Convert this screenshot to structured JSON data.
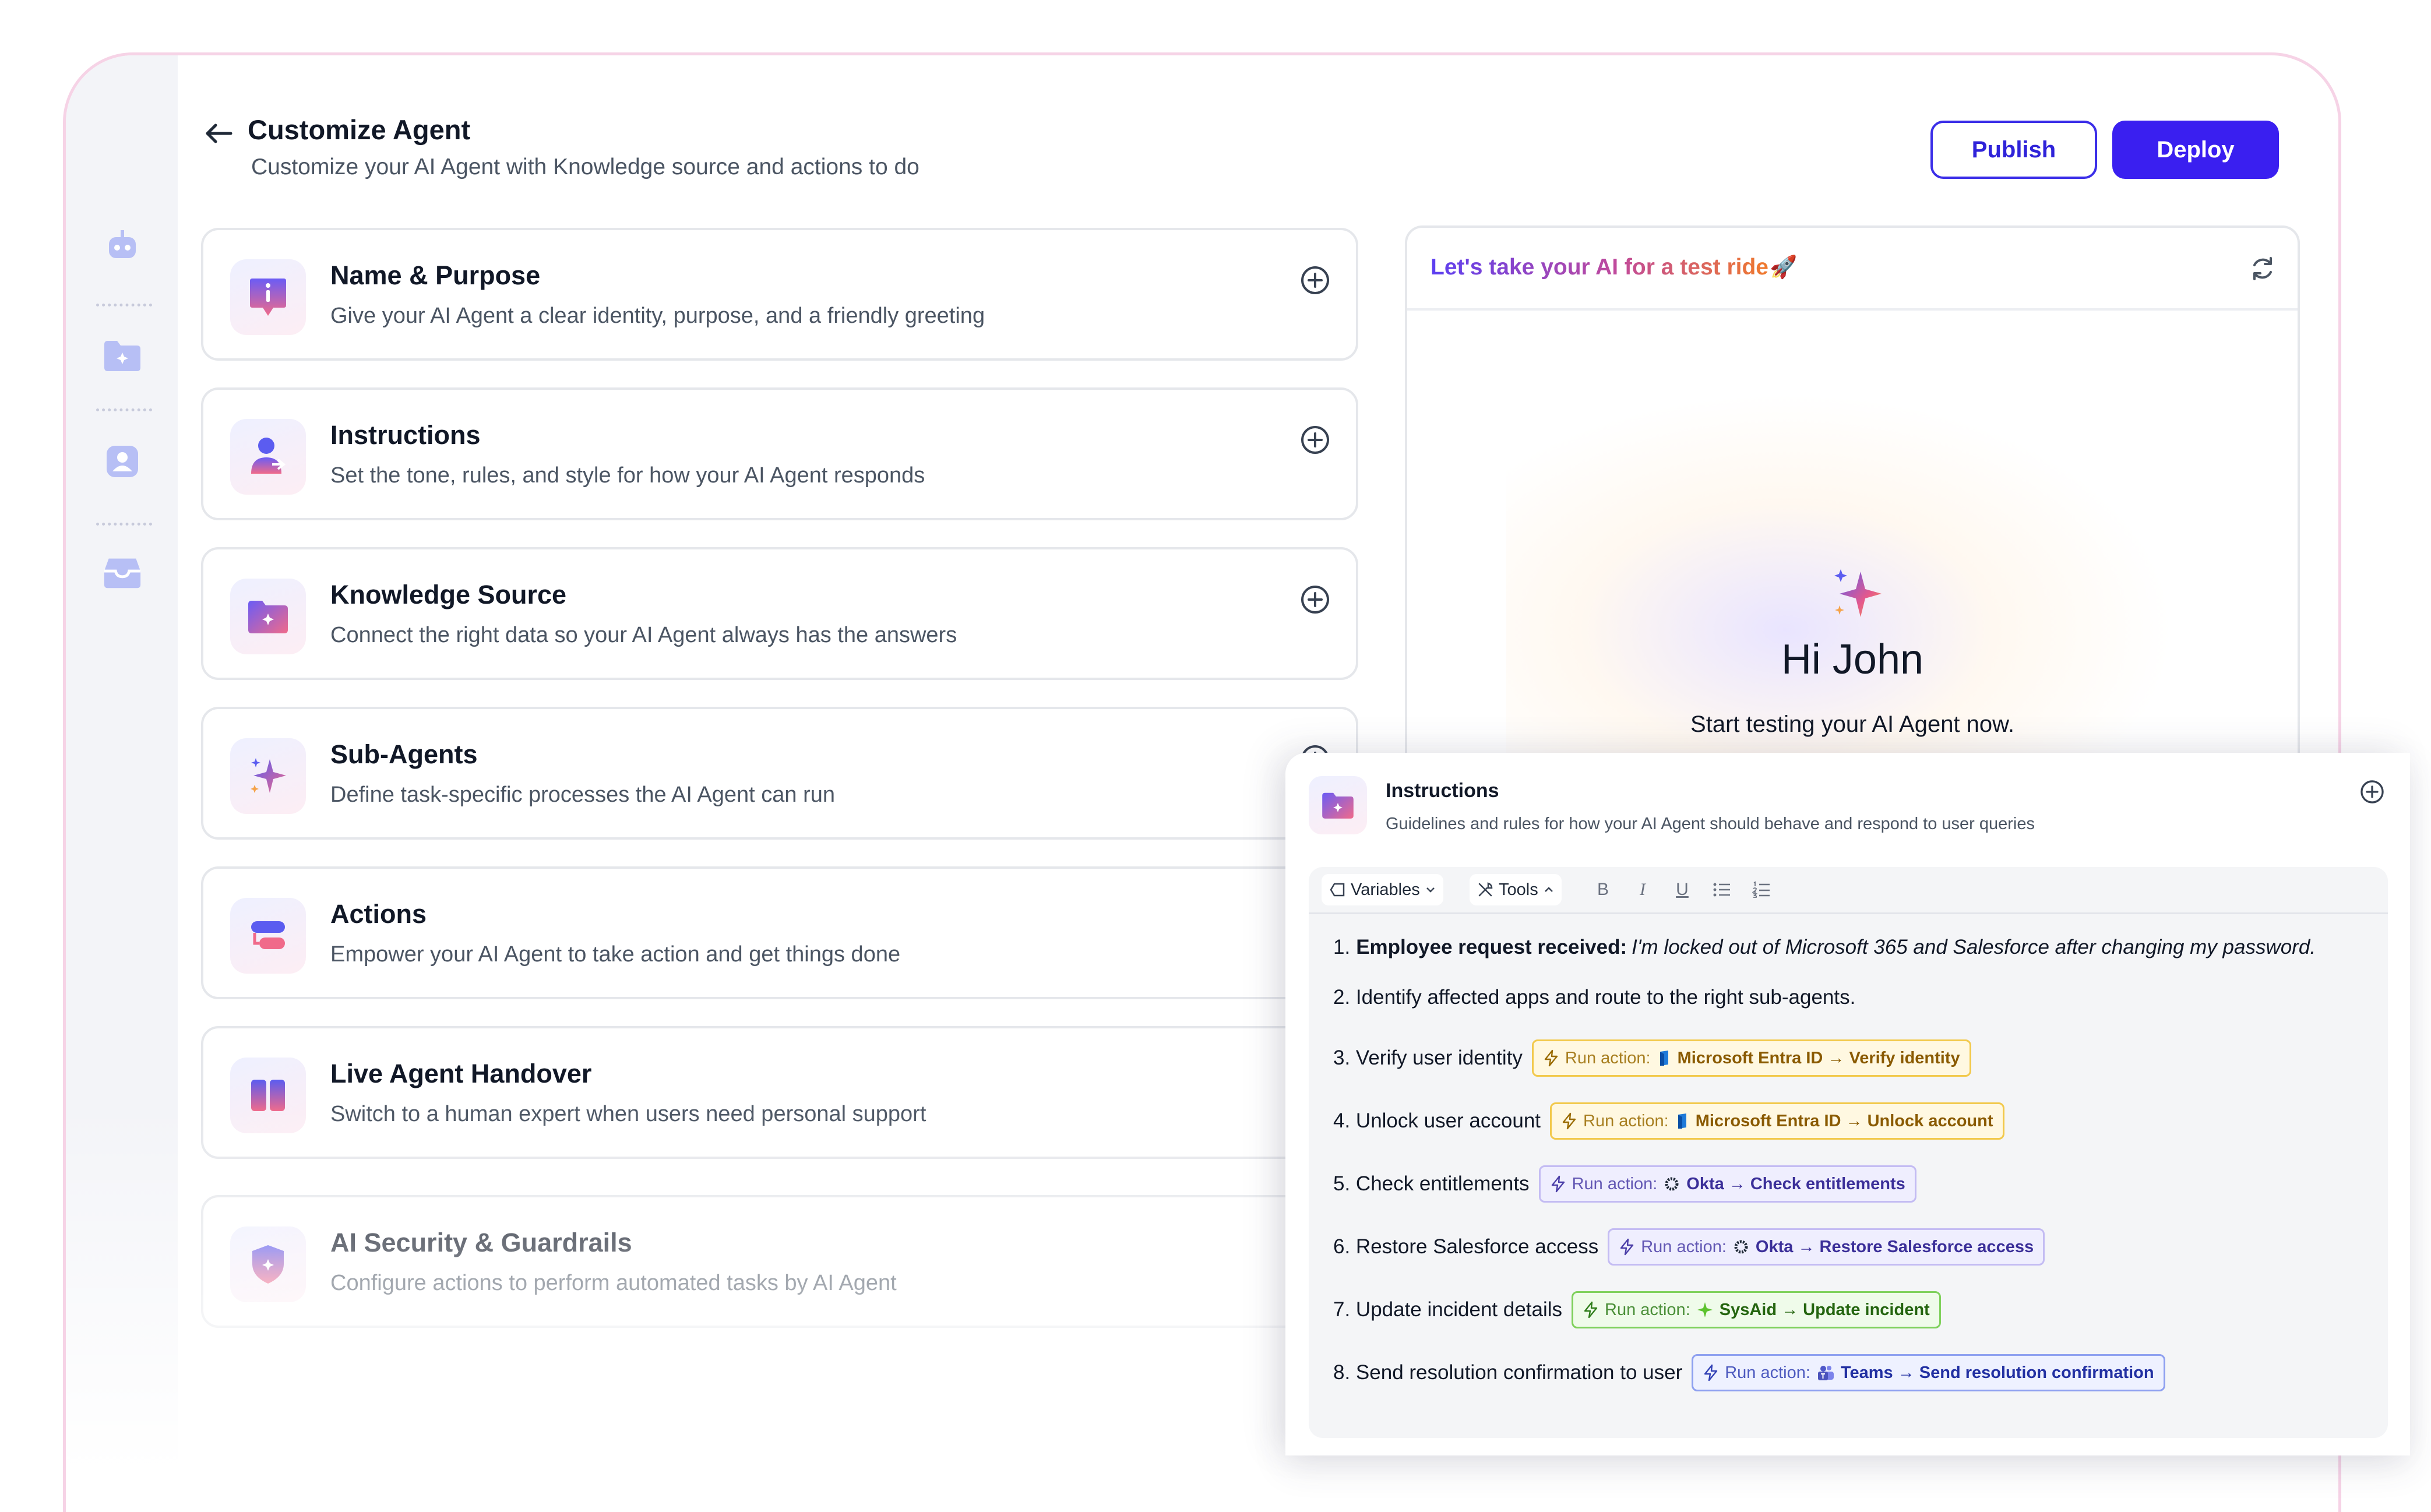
{
  "header": {
    "title": "Customize Agent",
    "subtitle": "Customize your AI Agent with Knowledge source and actions to do",
    "publish_label": "Publish",
    "deploy_label": "Deploy"
  },
  "sidebar": {
    "items": [
      "robot-icon",
      "folder-sparkle-icon",
      "user-card-icon",
      "inbox-icon"
    ]
  },
  "cards": [
    {
      "title": "Name & Purpose",
      "desc": "Give your AI Agent a clear identity, purpose, and a friendly greeting",
      "icon": "info-badge-icon"
    },
    {
      "title": "Instructions",
      "desc": "Set the tone, rules, and style for how your AI Agent responds",
      "icon": "user-edit-icon"
    },
    {
      "title": "Knowledge Source",
      "desc": "Connect the right data so your AI Agent always has the answers",
      "icon": "folder-sparkle-icon"
    },
    {
      "title": "Sub-Agents",
      "desc": "Define task-specific processes the AI Agent can run",
      "icon": "sparkle-icon"
    },
    {
      "title": "Actions",
      "desc": "Empower your AI Agent to take action and get things done",
      "icon": "actions-icon"
    },
    {
      "title": "Live Agent Handover",
      "desc": "Switch to a human expert when users need personal support",
      "icon": "handover-icon"
    },
    {
      "title": "AI Security & Guardrails",
      "desc": "Configure actions to perform automated tasks by AI Agent",
      "icon": "shield-icon"
    }
  ],
  "test_panel": {
    "title": "Let's take your AI for a test ride",
    "rocket": "🚀",
    "greeting": "Hi John",
    "prompt": "Start testing your AI Agent now."
  },
  "instructions_panel": {
    "title": "Instructions",
    "desc": "Guidelines and rules for how your AI Agent should behave and respond to user queries",
    "toolbar": {
      "variables_label": "Variables",
      "tools_label": "Tools",
      "bold": "B",
      "italic": "I",
      "underline": "U"
    },
    "step1": {
      "num": "1.",
      "label": "Employee request received:",
      "quote": "I'm locked out of Microsoft 365 and Salesforce after changing my password."
    },
    "step2": {
      "text": "2. Identify affected apps and route to the right sub-agents."
    },
    "steps": [
      {
        "text": "3. Verify user identity",
        "action_label": "Run action:",
        "target": "Microsoft Entra ID → Verify identity",
        "color": "yellow"
      },
      {
        "text": "4. Unlock user account",
        "action_label": "Run action:",
        "target": "Microsoft Entra ID → Unlock account",
        "color": "yellow"
      },
      {
        "text": "5.  Check entitlements",
        "action_label": "Run action:",
        "target": "Okta → Check entitlements",
        "color": "purple"
      },
      {
        "text": "6. Restore Salesforce access",
        "action_label": "Run action:",
        "target": "Okta → Restore Salesforce access",
        "color": "purple"
      },
      {
        "text": "7. Update incident details",
        "action_label": "Run action:",
        "target": "SysAid → Update incident",
        "color": "green"
      },
      {
        "text": "8. Send resolution confirmation to user",
        "action_label": "Run action:",
        "target": "Teams → Send resolution confirmation",
        "color": "blue"
      }
    ]
  },
  "colors": {
    "accent": "#3a1ff0",
    "gradient_start": "#5b3ff2",
    "gradient_end": "#f07a2c"
  }
}
